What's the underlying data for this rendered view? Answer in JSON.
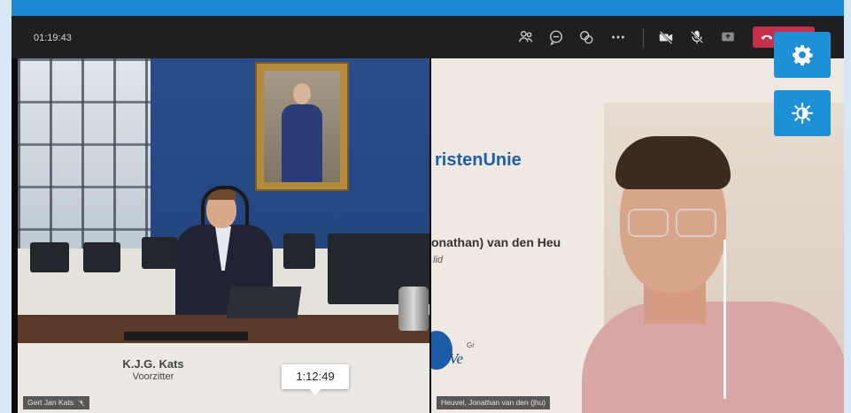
{
  "toolbar": {
    "elapsed_time": "01:19:43",
    "icons": [
      "participants-icon",
      "chat-icon",
      "reactions-icon",
      "more-options-icon",
      "camera-off-icon",
      "mic-off-icon",
      "share-screen-icon",
      "hang-up-icon"
    ]
  },
  "left_video": {
    "participant_label": "Gert Jan Kats",
    "name_card_line1": "K.J.G. Kats",
    "name_card_line2": "Voorzitter"
  },
  "right_video": {
    "participant_label": "Heuvel, Jonathan van den (jhu)",
    "background_party": "ristenUnie",
    "background_name": "onathan) van den Heu",
    "background_role": "lid",
    "background_logo_text": "Ve",
    "background_logo_sup": "Gr"
  },
  "tooltip": {
    "time": "1:12:49"
  },
  "side_buttons": [
    "settings-gear-icon",
    "brightness-icon"
  ],
  "colors": {
    "accent": "#1e90d8",
    "top_strip": "#1c8ad6",
    "leave": "#c4314b"
  }
}
